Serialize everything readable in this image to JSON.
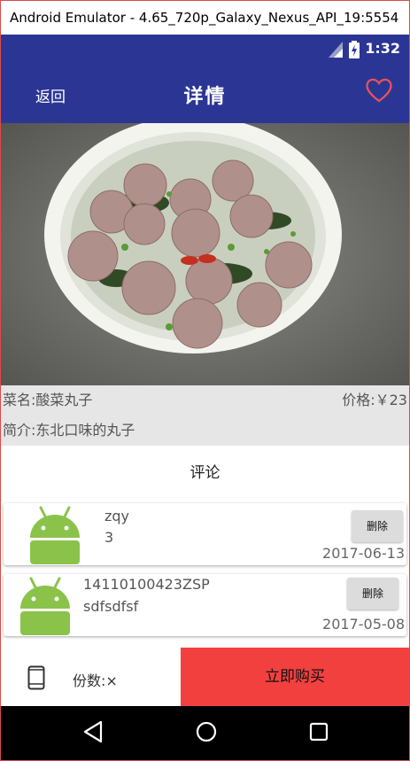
{
  "window": {
    "title": "Android Emulator - 4.65_720p_Galaxy_Nexus_API_19:5554"
  },
  "statusbar": {
    "time": "1:32"
  },
  "appbar": {
    "back_label": "返回",
    "title": "详情"
  },
  "dish": {
    "name": "菜名:酸菜丸子",
    "price": "价格:￥23",
    "intro": "简介:东北口味的丸子"
  },
  "comments": {
    "title": "评论",
    "items": [
      {
        "user": "zqy",
        "text": "3",
        "date": "2017-06-13",
        "delete_label": "删除"
      },
      {
        "user": "14110100423ZSP",
        "text": "sdfsdfsf",
        "date": "2017-05-08",
        "delete_label": "删除"
      }
    ]
  },
  "bottom": {
    "quantity_label": "份数:×",
    "buy_label": "立即购买"
  },
  "colors": {
    "primary": "#2b3694",
    "accent": "#f2403f",
    "android": "#8bc34a"
  }
}
